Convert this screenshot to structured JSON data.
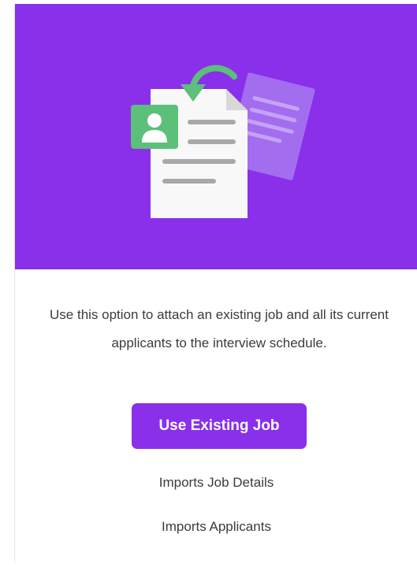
{
  "option_card": {
    "illustration_icon": "attach-existing-job-icon",
    "description": "Use this option to attach an existing job and all its current applicants to the interview schedule.",
    "button_label": "Use Existing Job",
    "features": [
      "Imports Job Details",
      "Imports Applicants"
    ]
  },
  "colors": {
    "accent": "#8a2fea",
    "button_text": "#ffffff",
    "body_text": "#3b3b3b",
    "illustration_green": "#5cbf7a",
    "document_fill": "#f8f8f8",
    "document_lines": "#a8a8a8"
  }
}
